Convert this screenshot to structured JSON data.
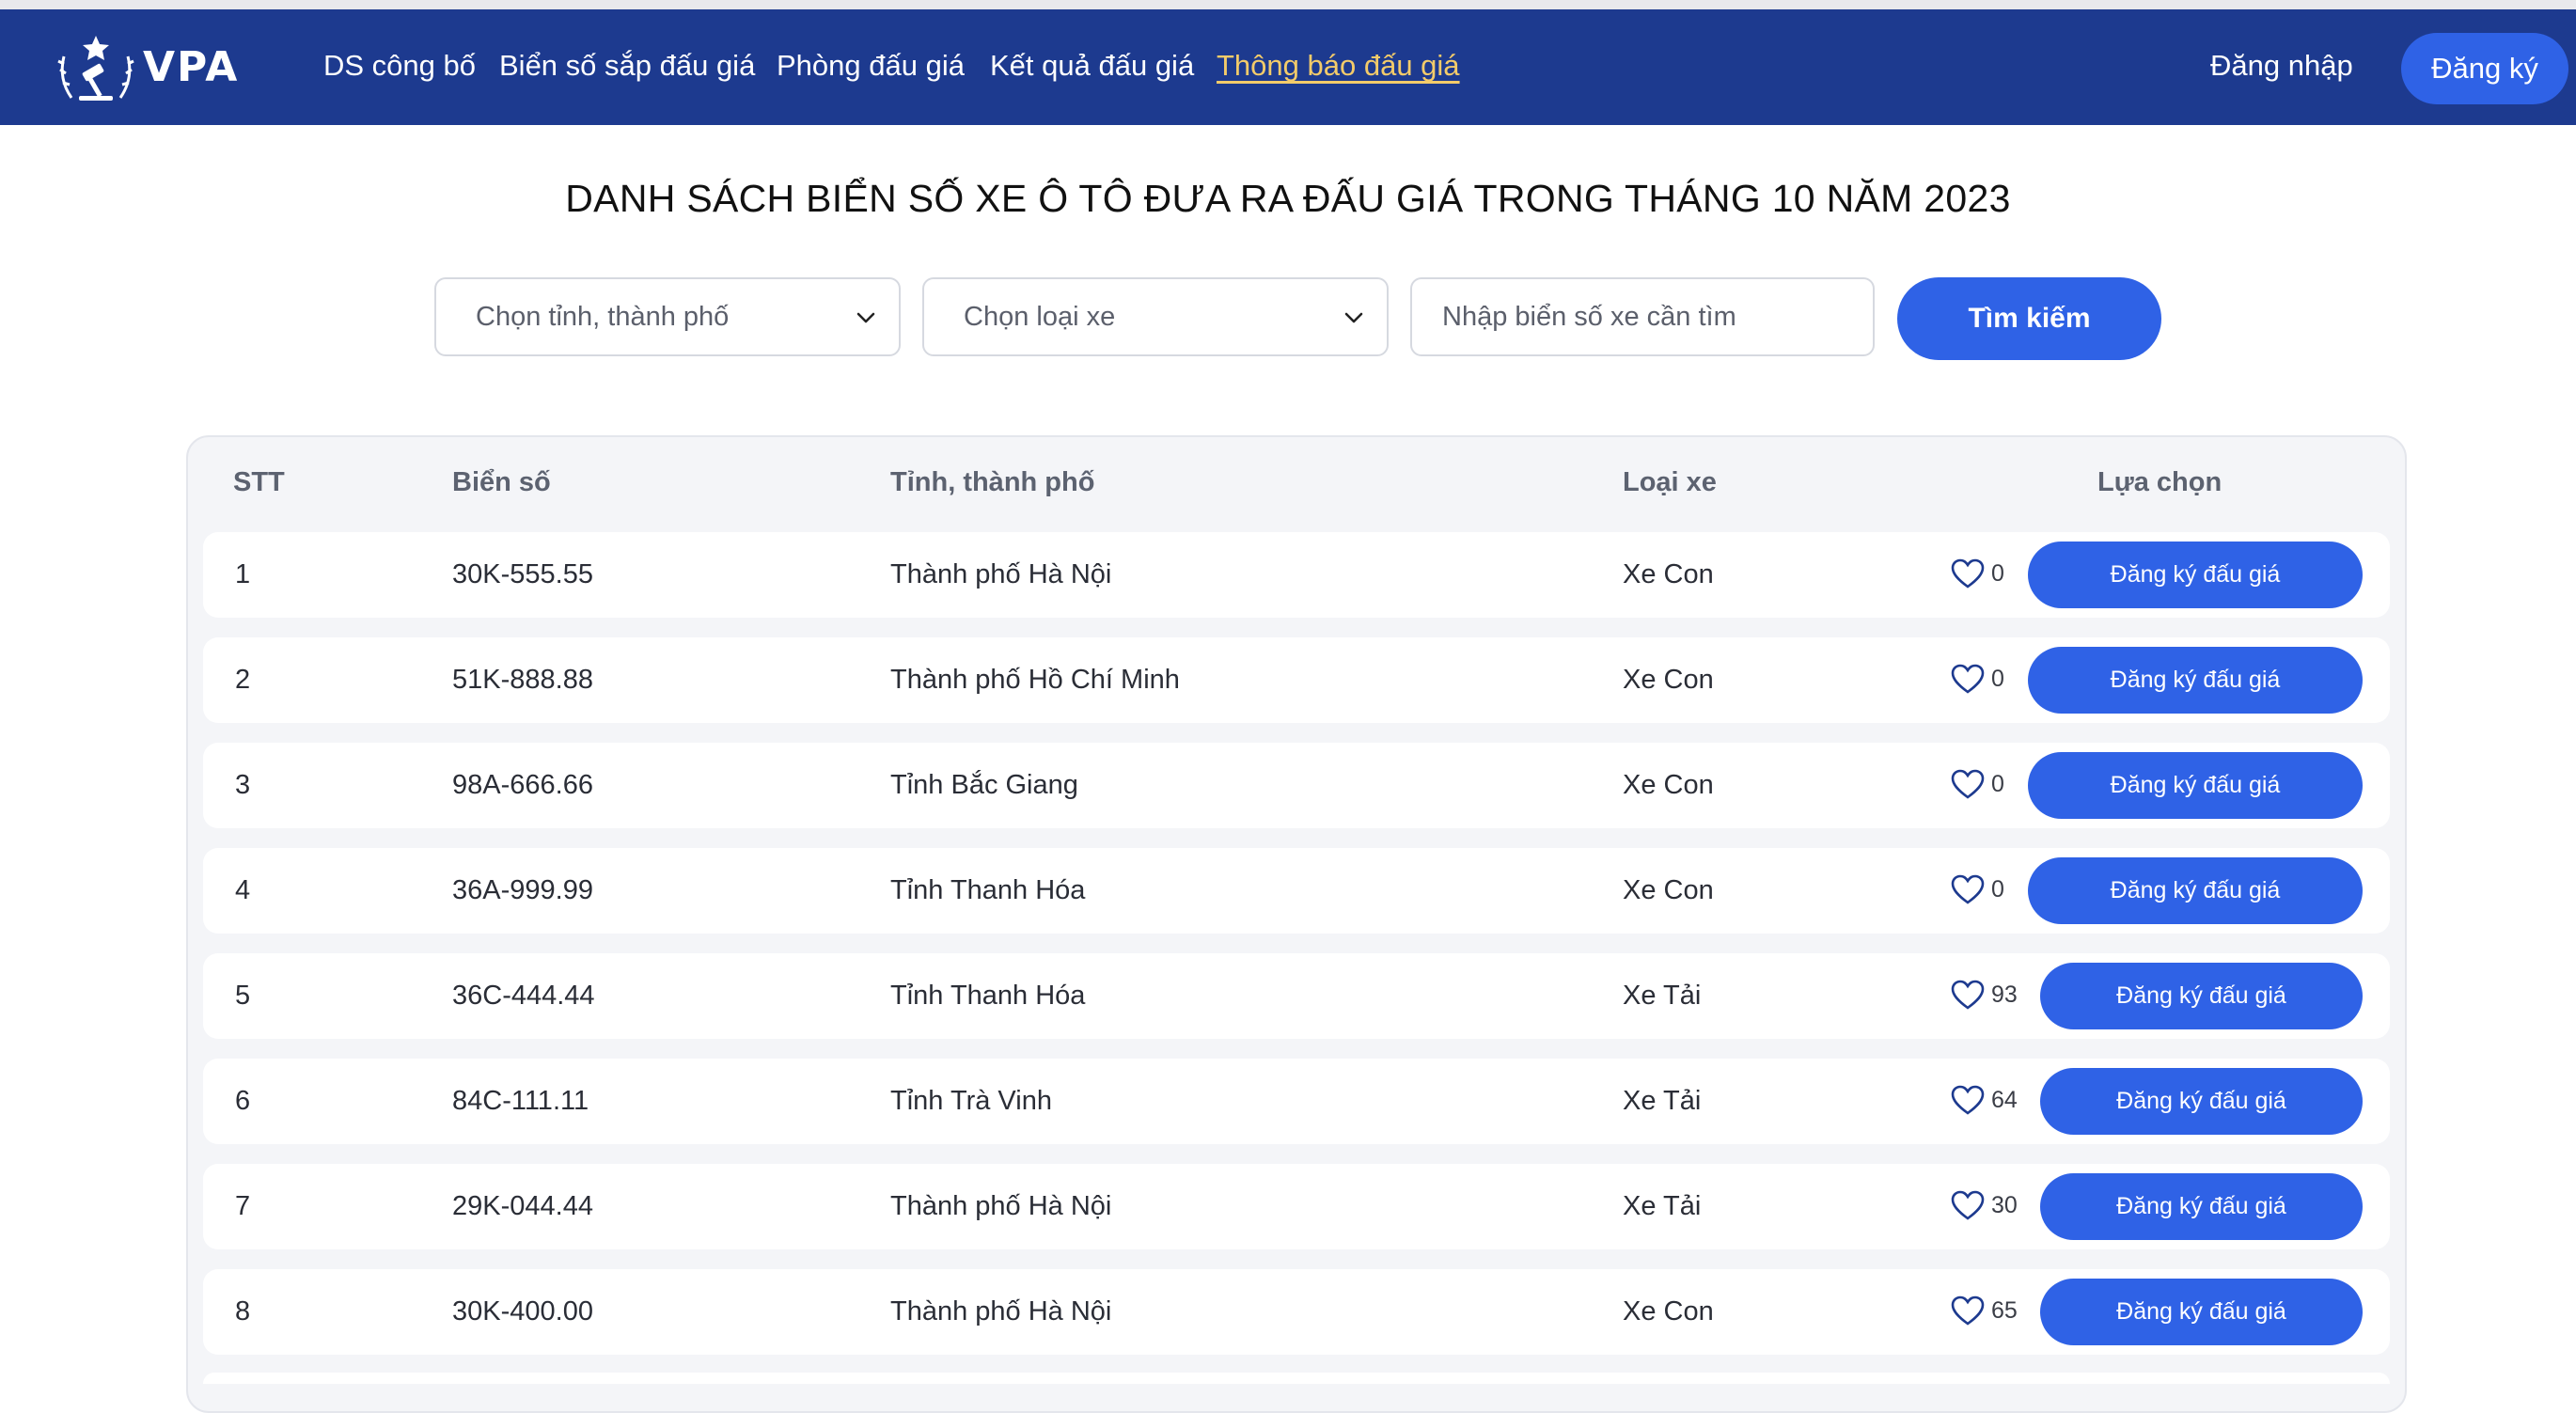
{
  "nav": {
    "brand": "VPA",
    "links": [
      "DS công bố",
      "Biển số sắp đấu giá",
      "Phòng đấu giá",
      "Kết quả đấu giá",
      "Thông báo đấu giá"
    ],
    "active_link": "Thông báo đấu giá",
    "login": "Đăng nhập",
    "register": "Đăng ký"
  },
  "page": {
    "title": "DANH SÁCH BIỂN SỐ XE Ô TÔ ĐƯA RA ĐẤU GIÁ TRONG THÁNG 10 NĂM 2023"
  },
  "filters": {
    "province_placeholder": "Chọn tỉnh, thành phố",
    "vehicle_placeholder": "Chọn loại xe",
    "plate_placeholder": "Nhập biển số xe cần tìm",
    "search_label": "Tìm kiếm"
  },
  "table": {
    "headers": [
      "STT",
      "Biển số",
      "Tỉnh, thành phố",
      "Loại xe",
      "Lựa chọn"
    ],
    "register_label": "Đăng ký đấu giá",
    "rows": [
      {
        "stt": "1",
        "plate": "30K-555.55",
        "province": "Thành phố Hà Nội",
        "type": "Xe Con",
        "likes": "0"
      },
      {
        "stt": "2",
        "plate": "51K-888.88",
        "province": "Thành phố Hồ Chí Minh",
        "type": "Xe Con",
        "likes": "0"
      },
      {
        "stt": "3",
        "plate": "98A-666.66",
        "province": "Tỉnh Bắc Giang",
        "type": "Xe Con",
        "likes": "0"
      },
      {
        "stt": "4",
        "plate": "36A-999.99",
        "province": "Tỉnh Thanh Hóa",
        "type": "Xe Con",
        "likes": "0"
      },
      {
        "stt": "5",
        "plate": "36C-444.44",
        "province": "Tỉnh Thanh Hóa",
        "type": "Xe Tải",
        "likes": "93"
      },
      {
        "stt": "6",
        "plate": "84C-111.11",
        "province": "Tỉnh Trà Vinh",
        "type": "Xe Tải",
        "likes": "64"
      },
      {
        "stt": "7",
        "plate": "29K-044.44",
        "province": "Thành phố Hà Nội",
        "type": "Xe Tải",
        "likes": "30"
      },
      {
        "stt": "8",
        "plate": "30K-400.00",
        "province": "Thành phố Hà Nội",
        "type": "Xe Con",
        "likes": "65"
      }
    ]
  },
  "colors": {
    "navbar": "#1d3a8f",
    "primary_button": "#2f62e6",
    "active_nav": "#f3cb6a"
  },
  "icons": [
    "vpa-logo-icon",
    "chevron-down-icon",
    "heart-icon"
  ]
}
